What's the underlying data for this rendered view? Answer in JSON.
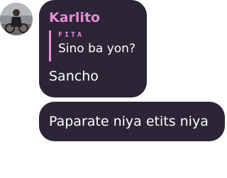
{
  "conversation": {
    "messages": [
      {
        "sender": "Karlito",
        "reply_to": {
          "name": "FITA",
          "text": "Sino ba yon?"
        },
        "text": "Sancho"
      },
      {
        "text": "Paparate niya etits niya"
      }
    ]
  },
  "colors": {
    "bubble": "#2b2536",
    "accent": "#e98ad6",
    "text": "#ffffff"
  }
}
